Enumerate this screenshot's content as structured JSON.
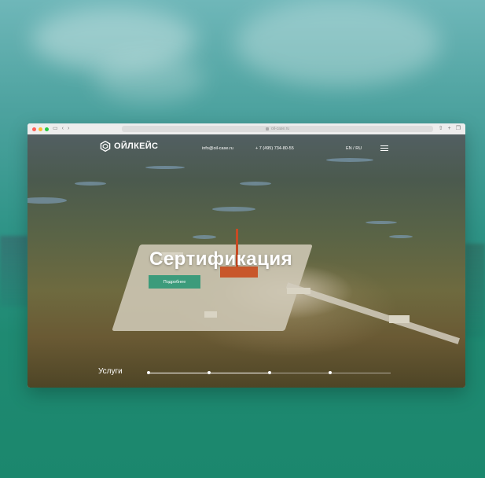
{
  "browser": {
    "address_text": "oil-case.ru",
    "nav_icons": [
      "sidebar-icon",
      "back-icon",
      "forward-icon"
    ],
    "right_icons": [
      "share-icon",
      "new-tab-icon",
      "tabs-icon"
    ]
  },
  "site": {
    "logo_text": "ОЙЛКЕЙС",
    "email": "info@oil-case.ru",
    "phone": "+ 7 (495) 734-80-55",
    "lang_en": "EN",
    "lang_sep": "/",
    "lang_ru": "RU",
    "hero_title": "Сертификация",
    "cta_label": "Подробнее",
    "section_label": "Услуги",
    "slider": {
      "count": 4,
      "active_index": 1
    }
  },
  "colors": {
    "accent": "#3c9b7b",
    "backdrop": "#1b876d"
  }
}
